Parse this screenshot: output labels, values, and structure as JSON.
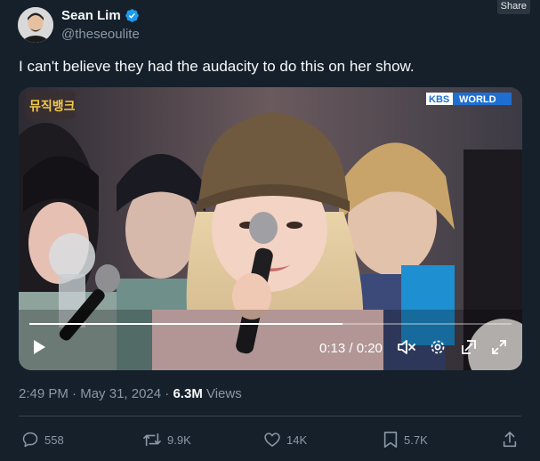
{
  "share_label": "Share",
  "author": {
    "name": "Sean Lim",
    "handle": "@theseoulite",
    "verified": true
  },
  "tweet": {
    "text": "I can't believe they had the audacity to do this on her show."
  },
  "video": {
    "broadcaster_badge": "KBS",
    "broadcaster_label": "WORLD",
    "show_logo_text": "뮤직뱅크",
    "current_time": "0:13",
    "duration": "0:20",
    "time_readout": "0:13 / 0:20",
    "progress_fraction": 0.65,
    "icons": {
      "play": "play-icon",
      "mute": "speaker-muted-icon",
      "settings": "gear-icon",
      "popout": "picture-in-picture-icon",
      "fullscreen": "expand-icon"
    }
  },
  "meta": {
    "time": "2:49 PM",
    "separator": " · ",
    "date": "May 31, 2024",
    "dot": " · ",
    "views_count": "6.3M",
    "views_label": " Views"
  },
  "actions": {
    "replies": "558",
    "reposts": "9.9K",
    "likes": "14K",
    "bookmarks": "5.7K"
  },
  "colors": {
    "background": "#15202b",
    "text": "#f7f9f9",
    "secondary": "#8b98a5",
    "verified": "#1d9bf0",
    "kbs_blue": "#1f6fd1"
  }
}
